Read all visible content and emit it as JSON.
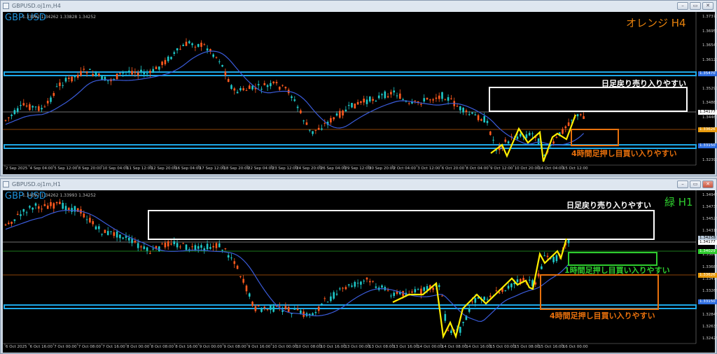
{
  "windows": [
    {
      "title": "GBPUSD.oj1m,H4",
      "symbol": "GBP USD",
      "ohlc": "1.33992 1.34262 1.33828 1.34252",
      "timeframe_label": "オレンジ H4",
      "timeframe_color": "#e8820c",
      "annotations": {
        "sell_zone": "日足戻り売り入りやすい",
        "buy_zone_h4": "4時間足押し目買い入りやすい"
      },
      "price_ticks": [
        "1.37370",
        "1.36950",
        "1.36540",
        "1.36120",
        "1.35710",
        "1.35290",
        "1.34880",
        "1.34460",
        "1.34050",
        "1.32800",
        "1.32390"
      ],
      "price_tags": {
        "upper_blue": "1.35470",
        "white": "1.34177",
        "orange": "1.33626",
        "lower_blue": "1.33150"
      },
      "time_ticks": [
        "2 Sep 2025",
        "4 Sep 04:00",
        "5 Sep 12:00",
        "8 Sep 20:00",
        "10 Sep 04:00",
        "11 Sep 12:00",
        "12 Sep 20:00",
        "16 Sep 04:00",
        "17 Sep 12:00",
        "18 Sep 20:00",
        "22 Sep 04:00",
        "23 Sep 12:00",
        "24 Sep 20:00",
        "26 Sep 04:00",
        "29 Sep 12:00",
        "30 Sep 20:00",
        "2 Oct 04:00",
        "3 Oct 12:00",
        "6 Oct 20:00",
        "8 Oct 04:00",
        "9 Oct 12:00",
        "10 Oct 20:00",
        "14 Oct 04:00",
        "15 Oct 12:00"
      ]
    },
    {
      "title": "GBPUSD.oj1m,H1",
      "symbol": "GBP USD",
      "ohlc": "1.34027 1.34262 1.33993 1.34252",
      "timeframe_label": "緑 H1",
      "timeframe_color": "#2ecc2e",
      "annotations": {
        "sell_zone": "日足戻り売り入りやすい",
        "buy_zone_h1": "1時間足押し目買い入りやすい",
        "buy_zone_h4": "4時間足押し目買い入りやすい"
      },
      "price_ticks": [
        "1.34945",
        "1.34735",
        "1.34525",
        "1.34315",
        "1.34105",
        "1.33895",
        "1.33685",
        "1.33475",
        "1.33265",
        "1.33055",
        "1.32845",
        "1.32635",
        "1.32425"
      ],
      "price_tags": {
        "current": "1.34258",
        "white": "1.34177",
        "green": "1.34029",
        "orange": "1.33626",
        "blue": "1.33150"
      },
      "time_ticks": [
        "6 Oct 2025",
        "6 Oct 16:00",
        "7 Oct 00:00",
        "7 Oct 08:00",
        "7 Oct 16:00",
        "8 Oct 00:00",
        "8 Oct 08:00",
        "8 Oct 16:00",
        "9 Oct 00:00",
        "9 Oct 08:00",
        "9 Oct 16:00",
        "10 Oct 00:00",
        "10 Oct 08:00",
        "10 Oct 16:00",
        "13 Oct 00:00",
        "13 Oct 08:00",
        "13 Oct 16:00",
        "14 Oct 00:00",
        "14 Oct 08:00",
        "14 Oct 16:00",
        "15 Oct 00:00",
        "15 Oct 08:00",
        "15 Oct 16:00",
        "16 Oct 00:00"
      ]
    }
  ],
  "colors": {
    "bull": "#1ec8c8",
    "bear": "#ff5a1e",
    "ma": "#3a5bd9",
    "zigzag": "#ffee00",
    "blue_band": "#1ea8e8",
    "orange": "#e8700c",
    "green": "#2ecc2e",
    "white": "#ffffff"
  }
}
